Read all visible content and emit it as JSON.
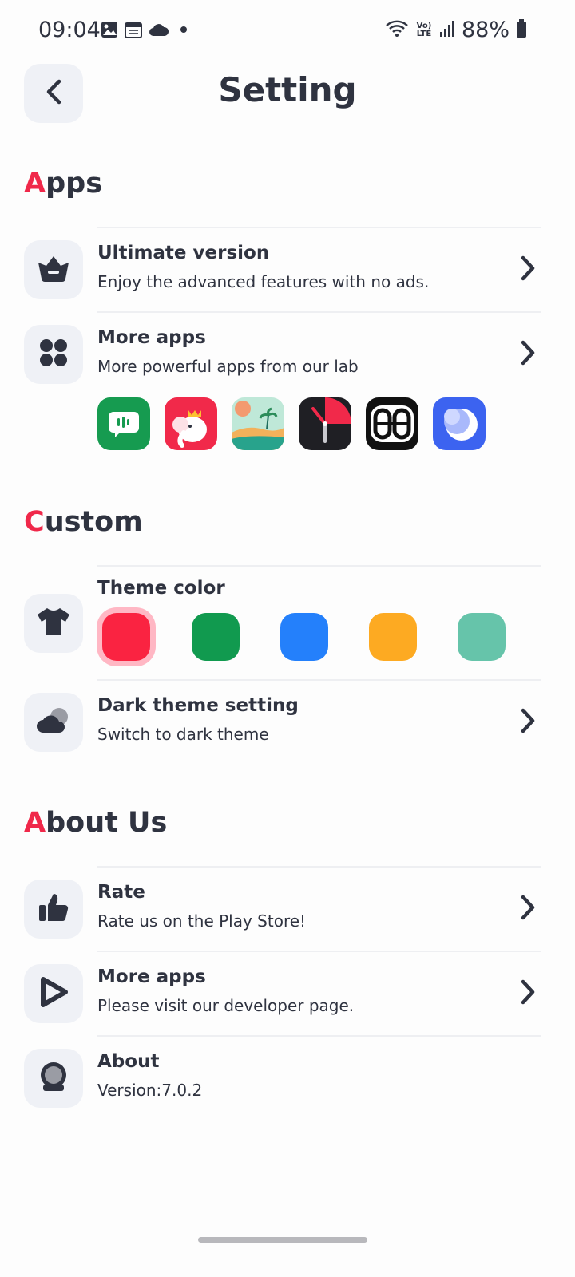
{
  "status_bar": {
    "time": "09:04",
    "network_badge": "Vo) LTE",
    "battery": "88%"
  },
  "header": {
    "title": "Setting"
  },
  "sections": {
    "apps": {
      "first": "A",
      "rest": "pps"
    },
    "custom": {
      "first": "C",
      "rest": "ustom"
    },
    "about": {
      "first": "A",
      "rest": "bout Us"
    }
  },
  "rows": {
    "ultimate": {
      "title": "Ultimate version",
      "subtitle": "Enjoy the advanced features with no ads.",
      "icon": "crown-basket-icon"
    },
    "more_apps_lab": {
      "title": "More apps",
      "subtitle": "More powerful apps from our lab",
      "icon": "grid-dots-icon"
    },
    "theme": {
      "title": "Theme color",
      "icon": "tshirt-icon"
    },
    "dark": {
      "title": "Dark theme setting",
      "subtitle": "Switch to dark theme",
      "icon": "cloud-moon-icon"
    },
    "rate": {
      "title": "Rate",
      "subtitle": "Rate us on the Play Store!",
      "icon": "thumbs-up-icon"
    },
    "more_apps_dev": {
      "title": "More apps",
      "subtitle": "Please visit our developer page.",
      "icon": "play-icon"
    },
    "about": {
      "title": "About",
      "subtitle": "Version:7.0.2",
      "icon": "astronaut-helmet-icon"
    }
  },
  "lab_apps": [
    {
      "icon": "chat-bot-app-icon",
      "color": "#169b50"
    },
    {
      "icon": "elephant-app-icon",
      "color": "#f1294a"
    },
    {
      "icon": "beach-app-icon",
      "color": "#bfe8d8"
    },
    {
      "icon": "clock-app-icon",
      "color": "#1f1f24"
    },
    {
      "icon": "link-app-icon",
      "color": "#111111"
    },
    {
      "icon": "moon-app-icon",
      "color": "#3c63f0"
    }
  ],
  "theme_colors": [
    {
      "color": "#fa2341",
      "selected": true
    },
    {
      "color": "#119a4f",
      "selected": false
    },
    {
      "color": "#2480fb",
      "selected": false
    },
    {
      "color": "#fdaa22",
      "selected": false
    },
    {
      "color": "#66c4aa",
      "selected": false
    }
  ]
}
